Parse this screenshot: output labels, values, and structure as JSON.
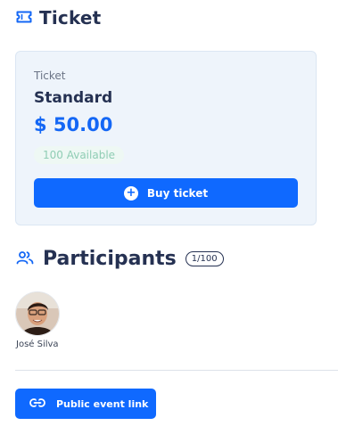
{
  "ticket_section": {
    "title": "Ticket",
    "icon": "ticket-icon",
    "card": {
      "label": "Ticket",
      "type": "Standard",
      "price": "$ 50.00",
      "availability": "100 Available",
      "buy_label": "Buy ticket",
      "buy_icon": "plus-circle-icon"
    }
  },
  "participants": {
    "title": "Participants",
    "icon": "users-icon",
    "count": "1/100",
    "list": [
      {
        "name": "José Silva",
        "avatar": "avatar-photo"
      }
    ]
  },
  "footer": {
    "link_label": "Public event link",
    "link_icon": "link-icon"
  },
  "colors": {
    "primary": "#0f69ff",
    "heading": "#253152",
    "card_bg": "#eef4fb",
    "availability_text": "#8fcdb4"
  }
}
